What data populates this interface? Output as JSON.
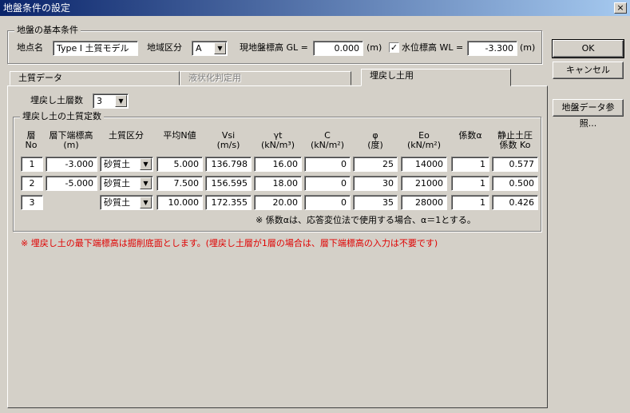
{
  "window": {
    "title": "地盤条件の設定",
    "close": "×"
  },
  "basic": {
    "group_label": "地盤の基本条件",
    "site_label": "地点名",
    "site_value": "Type I 土質モデル",
    "region_label": "地域区分",
    "region_value": "A",
    "gl_label": "現地盤標高 GL =",
    "gl_value": "0.000",
    "gl_unit": "(m)",
    "wl_checked": "✓",
    "wl_label": "水位標高 WL =",
    "wl_value": "-3.300",
    "wl_unit": "(m)"
  },
  "tabs": [
    {
      "label": "土質データ"
    },
    {
      "label": "液状化判定用"
    },
    {
      "label": "埋戻し土用"
    }
  ],
  "backfill": {
    "layers_label": "埋戻し土層数",
    "layers_value": "3",
    "group_label": "埋戻し土の土質定数",
    "headers": {
      "no": "層\nNo",
      "depth": "層下端標高\n(m)",
      "soil": "土質区分",
      "n": "平均N値",
      "vsi": "Vsi\n(m/s)",
      "gamma": "γt\n(kN/m³)",
      "c": "C\n(kN/m²)",
      "phi": "φ\n(度)",
      "eo": "Eo\n(kN/m²)",
      "alpha": "係数α",
      "ko": "静止土圧\n係数 Ko"
    },
    "rows": [
      {
        "no": "1",
        "depth": "-3.000",
        "soil": "砂質土",
        "n": "5.000",
        "vsi": "136.798",
        "gamma": "16.00",
        "c": "0",
        "phi": "25",
        "eo": "14000",
        "alpha": "1",
        "ko": "0.577"
      },
      {
        "no": "2",
        "depth": "-5.000",
        "soil": "砂質土",
        "n": "7.500",
        "vsi": "156.595",
        "gamma": "18.00",
        "c": "0",
        "phi": "30",
        "eo": "21000",
        "alpha": "1",
        "ko": "0.500"
      },
      {
        "no": "3",
        "depth": "",
        "soil": "砂質土",
        "n": "10.000",
        "vsi": "172.355",
        "gamma": "20.00",
        "c": "0",
        "phi": "35",
        "eo": "28000",
        "alpha": "1",
        "ko": "0.426"
      }
    ],
    "alpha_note": "※ 係数αは、応答変位法で使用する場合、α＝1とする。",
    "bottom_note": "※ 埋戻し土の最下端標高は掘削底面とします。(埋戻し土層が1層の場合は、層下端標高の入力は不要です)"
  },
  "buttons": {
    "ok": "OK",
    "cancel": "キャンセル",
    "ref": "地盤データ参照..."
  },
  "colors": {
    "titlebar": "#0a246a",
    "note_red": "#e00000",
    "face": "#d4d0c8"
  }
}
